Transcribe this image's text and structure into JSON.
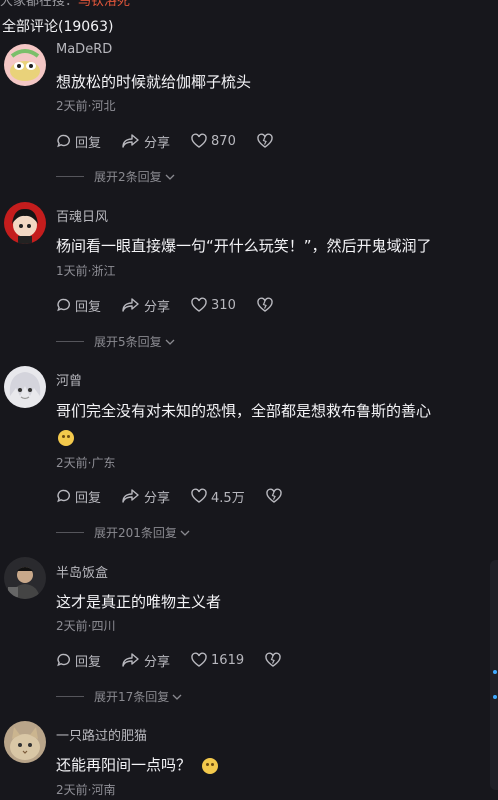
{
  "top": {
    "prefix": "大家都在搜：",
    "highlight": "马钦洛死"
  },
  "header": {
    "label": "全部评论",
    "count": "(19063)"
  },
  "comments": [
    {
      "name": "MaDeRD",
      "text": "想放松的时候就给伽椰子梳头",
      "meta": "2天前·河北",
      "reply": "回复",
      "share": "分享",
      "likes": "870",
      "expand": "展开2条回复"
    },
    {
      "name": "百魂日风",
      "text": "杨间看一眼直接爆一句“开什么玩笑！”，然后开鬼域润了",
      "meta": "1天前·浙江",
      "reply": "回复",
      "share": "分享",
      "likes": "310",
      "expand": "展开5条回复"
    },
    {
      "name": "河曾",
      "text": "哥们完全没有对未知的恐惧，全部都是想救布鲁斯的善心",
      "meta": "2天前·广东",
      "reply": "回复",
      "share": "分享",
      "likes": "4.5万",
      "expand": "展开201条回复"
    },
    {
      "name": "半岛饭盒",
      "text": "这才是真正的唯物主义者",
      "meta": "2天前·四川",
      "reply": "回复",
      "share": "分享",
      "likes": "1619",
      "expand": "展开17条回复"
    },
    {
      "name": "一只路过的肥猫",
      "text": "还能再阳间一点吗？",
      "meta": "2天前·河南"
    }
  ],
  "colors": {
    "background": "#17171c",
    "highlight": "#e2563a"
  }
}
